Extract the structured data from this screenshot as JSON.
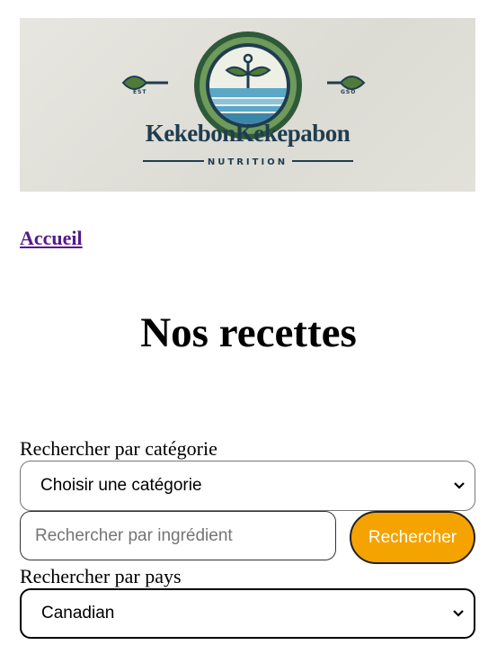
{
  "header": {
    "logo": {
      "brand_name": "KekebonKekepabon",
      "tagline": "NUTRITION",
      "est_left": "EST",
      "est_right": "GSO"
    },
    "nav_link": "Accueil"
  },
  "main": {
    "title": "Nos recettes",
    "category_label": "Rechercher par catégorie",
    "category_select_value": "Choisir une catégorie",
    "ingredient_placeholder": "Rechercher par ingrédient",
    "ingredient_value": "",
    "search_button": "Rechercher",
    "country_label": "Rechercher par pays",
    "country_select_value": "Canadian"
  },
  "colors": {
    "link": "#551a8b",
    "button_bg": "#f5a300",
    "button_text": "#ffffff",
    "logo_green": "#4f7b3a",
    "logo_blue": "#5aa7c8",
    "logo_navy": "#1f3d4f"
  }
}
